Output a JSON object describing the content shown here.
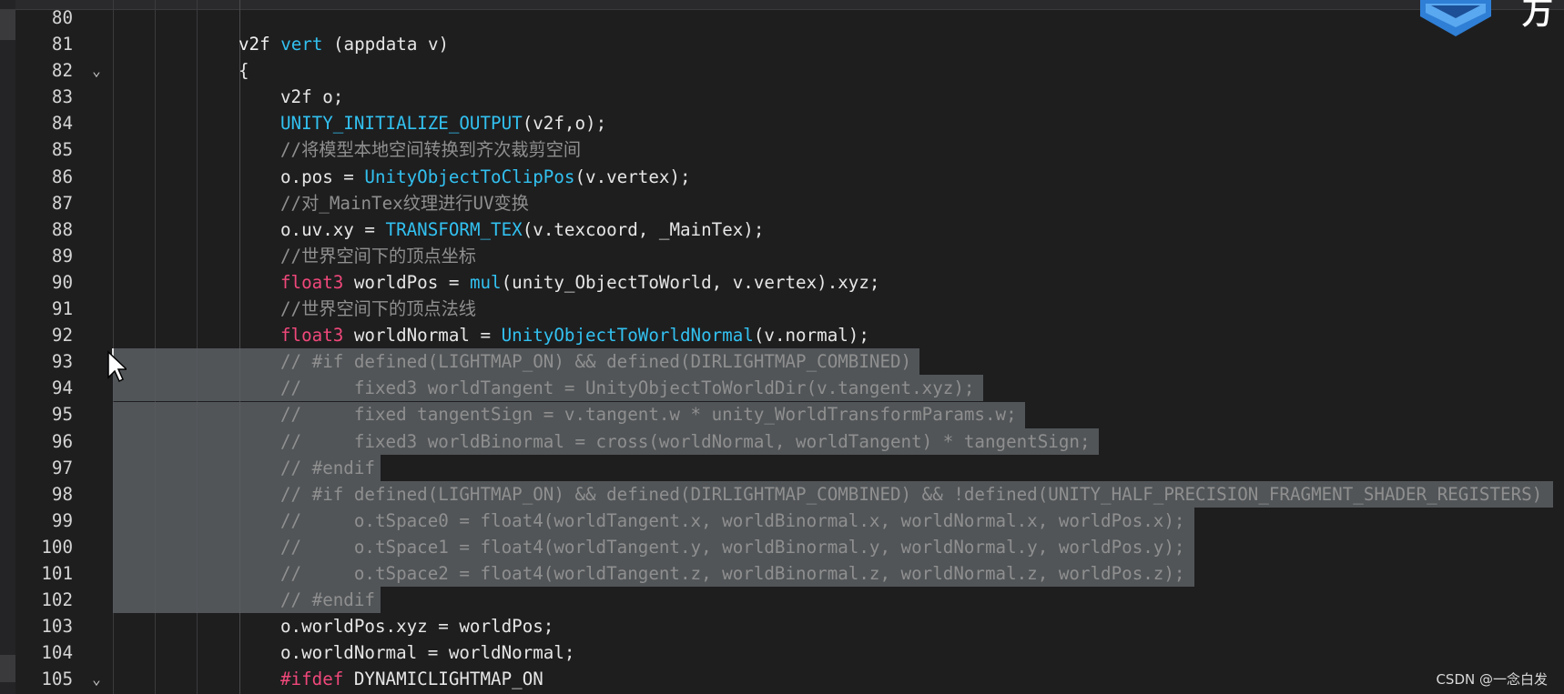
{
  "editor": {
    "lines": [
      {
        "num": "80",
        "fold": false,
        "indent": 0,
        "tokens": []
      },
      {
        "num": "81",
        "fold": false,
        "indent": 0,
        "tokens": [
          {
            "t": "v2f ",
            "c": "kw"
          },
          {
            "t": "vert",
            "c": "fn"
          },
          {
            "t": " (appdata v)",
            "c": "plain"
          }
        ]
      },
      {
        "num": "82",
        "fold": true,
        "indent": 0,
        "tokens": [
          {
            "t": "{",
            "c": "plain"
          }
        ]
      },
      {
        "num": "83",
        "fold": false,
        "indent": 1,
        "tokens": [
          {
            "t": "v2f o;",
            "c": "plain"
          }
        ]
      },
      {
        "num": "84",
        "fold": false,
        "indent": 1,
        "tokens": [
          {
            "t": "UNITY_INITIALIZE_OUTPUT",
            "c": "fn"
          },
          {
            "t": "(v2f,o);",
            "c": "plain"
          }
        ]
      },
      {
        "num": "85",
        "fold": false,
        "indent": 1,
        "tokens": [
          {
            "t": "//将模型本地空间转换到齐次裁剪空间",
            "c": "cm"
          }
        ]
      },
      {
        "num": "86",
        "fold": false,
        "indent": 1,
        "tokens": [
          {
            "t": "o.pos = ",
            "c": "plain"
          },
          {
            "t": "UnityObjectToClipPos",
            "c": "fn"
          },
          {
            "t": "(v.vertex);",
            "c": "plain"
          }
        ]
      },
      {
        "num": "87",
        "fold": false,
        "indent": 1,
        "tokens": [
          {
            "t": "//对_MainTex纹理进行UV变换",
            "c": "cm"
          }
        ]
      },
      {
        "num": "88",
        "fold": false,
        "indent": 1,
        "tokens": [
          {
            "t": "o.uv.xy = ",
            "c": "plain"
          },
          {
            "t": "TRANSFORM_TEX",
            "c": "fn"
          },
          {
            "t": "(v.texcoord, _MainTex);",
            "c": "plain"
          }
        ]
      },
      {
        "num": "89",
        "fold": false,
        "indent": 1,
        "tokens": [
          {
            "t": "//世界空间下的顶点坐标",
            "c": "cm"
          }
        ]
      },
      {
        "num": "90",
        "fold": false,
        "indent": 1,
        "tokens": [
          {
            "t": "float3",
            "c": "type"
          },
          {
            "t": " worldPos = ",
            "c": "plain"
          },
          {
            "t": "mul",
            "c": "fn"
          },
          {
            "t": "(unity_ObjectToWorld, v.vertex).xyz;",
            "c": "plain"
          }
        ]
      },
      {
        "num": "91",
        "fold": false,
        "indent": 1,
        "tokens": [
          {
            "t": "//世界空间下的顶点法线",
            "c": "cm"
          }
        ]
      },
      {
        "num": "92",
        "fold": false,
        "indent": 1,
        "tokens": [
          {
            "t": "float3",
            "c": "type"
          },
          {
            "t": " worldNormal = ",
            "c": "plain"
          },
          {
            "t": "UnityObjectToWorldNormal",
            "c": "fn"
          },
          {
            "t": "(v.normal);",
            "c": "plain"
          }
        ]
      },
      {
        "num": "93",
        "fold": false,
        "indent": 1,
        "tokens": [
          {
            "t": "// #if defined(LIGHTMAP_ON) && defined(DIRLIGHTMAP_COMBINED)",
            "c": "cm"
          }
        ]
      },
      {
        "num": "94",
        "fold": false,
        "indent": 1,
        "tokens": [
          {
            "t": "//     fixed3 worldTangent = UnityObjectToWorldDir(v.tangent.xyz);",
            "c": "cm"
          }
        ]
      },
      {
        "num": "95",
        "fold": false,
        "indent": 1,
        "tokens": [
          {
            "t": "//     fixed tangentSign = v.tangent.w * unity_WorldTransformParams.w;",
            "c": "cm"
          }
        ]
      },
      {
        "num": "96",
        "fold": false,
        "indent": 1,
        "tokens": [
          {
            "t": "//     fixed3 worldBinormal = cross(worldNormal, worldTangent) * tangentSign;",
            "c": "cm"
          }
        ]
      },
      {
        "num": "97",
        "fold": false,
        "indent": 1,
        "tokens": [
          {
            "t": "// #endif",
            "c": "cm"
          }
        ]
      },
      {
        "num": "98",
        "fold": false,
        "indent": 1,
        "tokens": [
          {
            "t": "// #if defined(LIGHTMAP_ON) && defined(DIRLIGHTMAP_COMBINED) && !defined(UNITY_HALF_PRECISION_FRAGMENT_SHADER_REGISTERS)",
            "c": "cm"
          }
        ]
      },
      {
        "num": "99",
        "fold": false,
        "indent": 1,
        "tokens": [
          {
            "t": "//     o.tSpace0 = float4(worldTangent.x, worldBinormal.x, worldNormal.x, worldPos.x);",
            "c": "cm"
          }
        ]
      },
      {
        "num": "100",
        "fold": false,
        "indent": 1,
        "tokens": [
          {
            "t": "//     o.tSpace1 = float4(worldTangent.y, worldBinormal.y, worldNormal.y, worldPos.y);",
            "c": "cm"
          }
        ]
      },
      {
        "num": "101",
        "fold": false,
        "indent": 1,
        "tokens": [
          {
            "t": "//     o.tSpace2 = float4(worldTangent.z, worldBinormal.z, worldNormal.z, worldPos.z);",
            "c": "cm"
          }
        ]
      },
      {
        "num": "102",
        "fold": false,
        "indent": 1,
        "tokens": [
          {
            "t": "// #endif",
            "c": "cm"
          }
        ]
      },
      {
        "num": "103",
        "fold": false,
        "indent": 1,
        "tokens": [
          {
            "t": "o.worldPos.xyz = worldPos;",
            "c": "plain"
          }
        ]
      },
      {
        "num": "104",
        "fold": false,
        "indent": 1,
        "tokens": [
          {
            "t": "o.worldNormal = worldNormal;",
            "c": "plain"
          }
        ]
      },
      {
        "num": "105",
        "fold": true,
        "indent": 1,
        "tokens": [
          {
            "t": "#ifdef",
            "c": "type"
          },
          {
            "t": " DYNAMICLIGHTMAP_ON",
            "c": "plain"
          }
        ]
      }
    ],
    "selected_lines": [
      "93",
      "94",
      "95",
      "96",
      "97",
      "98",
      "99",
      "100",
      "101",
      "102"
    ]
  },
  "logo": {
    "char": "万"
  },
  "watermark": "CSDN @一念白发",
  "colors": {
    "background": "#1e1e1f",
    "function": "#32c1f0",
    "type": "#f0487a",
    "comment": "#8f8f8f",
    "selection": "#5b5f63"
  }
}
